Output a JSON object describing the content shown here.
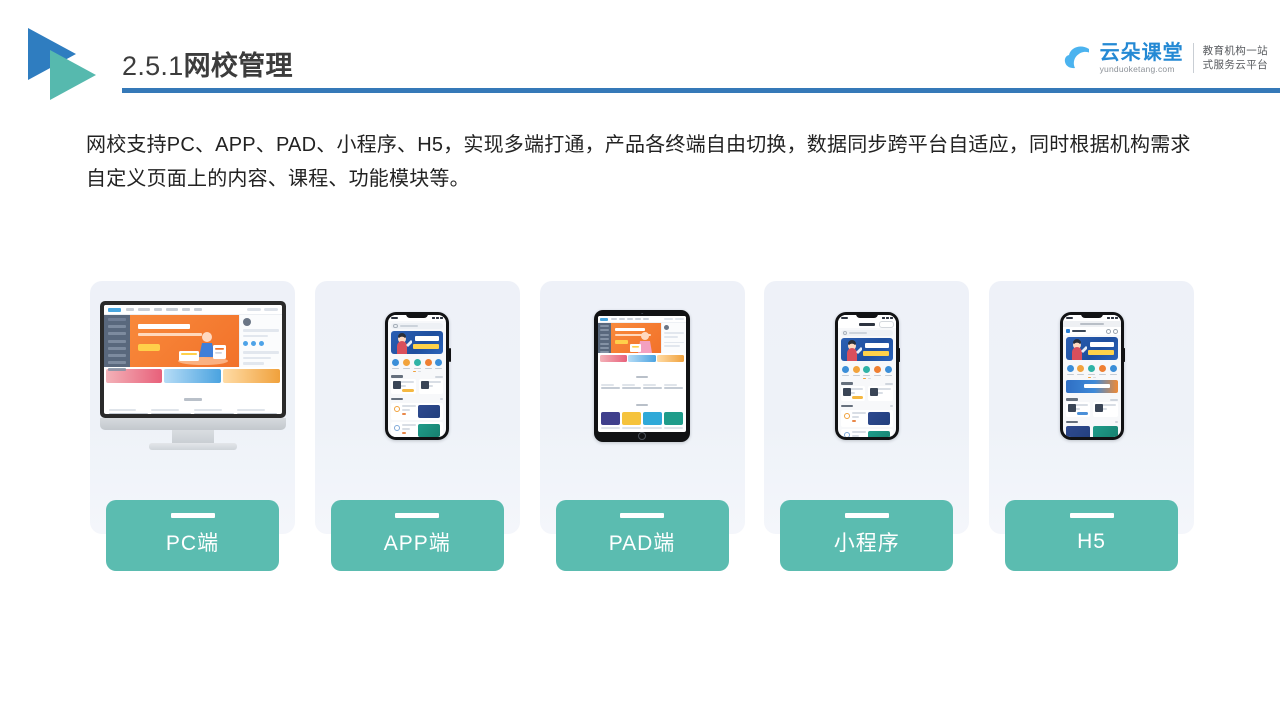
{
  "header": {
    "title_number": "2.5.1",
    "title_name": "网校管理",
    "logo_icon": "double-triangle-play-logo",
    "rule_color": "#3579b8"
  },
  "brand": {
    "icon": "cloud-icon",
    "name_cn": "云朵课堂",
    "domain": "yunduoketang.com",
    "tagline_line1": "教育机构一站",
    "tagline_line2": "式服务云平台",
    "color": "#2489d4"
  },
  "body": {
    "paragraph": "网校支持PC、APP、PAD、小程序、H5，实现多端打通，产品各终端自由切换，数据同步跨平台自适应，同时根据机构需求自定义页面上的内容、课程、功能模块等。"
  },
  "cards": [
    {
      "id": "pc",
      "label": "PC端",
      "device_icon": "desktop-monitor-icon",
      "label_color": "#5bbcb0"
    },
    {
      "id": "app",
      "label": "APP端",
      "device_icon": "smartphone-icon",
      "label_color": "#5bbcb0"
    },
    {
      "id": "pad",
      "label": "PAD端",
      "device_icon": "tablet-icon",
      "label_color": "#5bbcb0"
    },
    {
      "id": "miniprogram",
      "label": "小程序",
      "device_icon": "smartphone-icon",
      "label_color": "#5bbcb0"
    },
    {
      "id": "h5",
      "label": "H5",
      "device_icon": "smartphone-browser-icon",
      "label_color": "#5bbcb0"
    }
  ],
  "mock_palette": {
    "hero_orange": "#f2722a",
    "hero_blue": "#2b5fb3",
    "sidebar_slate": "#59687d",
    "grid_colors": [
      "#3f3f8c",
      "#f5c33c",
      "#2fa9d8",
      "#1f9c8a",
      "#2f4a7a",
      "#ef7f32",
      "#3a4a63",
      "#2f7fc4",
      "#f5c33c",
      "#2fa9d8",
      "#1f9c8a",
      "#ef7f32"
    ],
    "promo_colors": [
      "#e8607a",
      "#4aa3e0",
      "#f0a13c"
    ],
    "icon_colors": [
      "#3b8ed8",
      "#f2a33c",
      "#2fb3a6",
      "#ef7f32",
      "#3b8ed8"
    ]
  }
}
